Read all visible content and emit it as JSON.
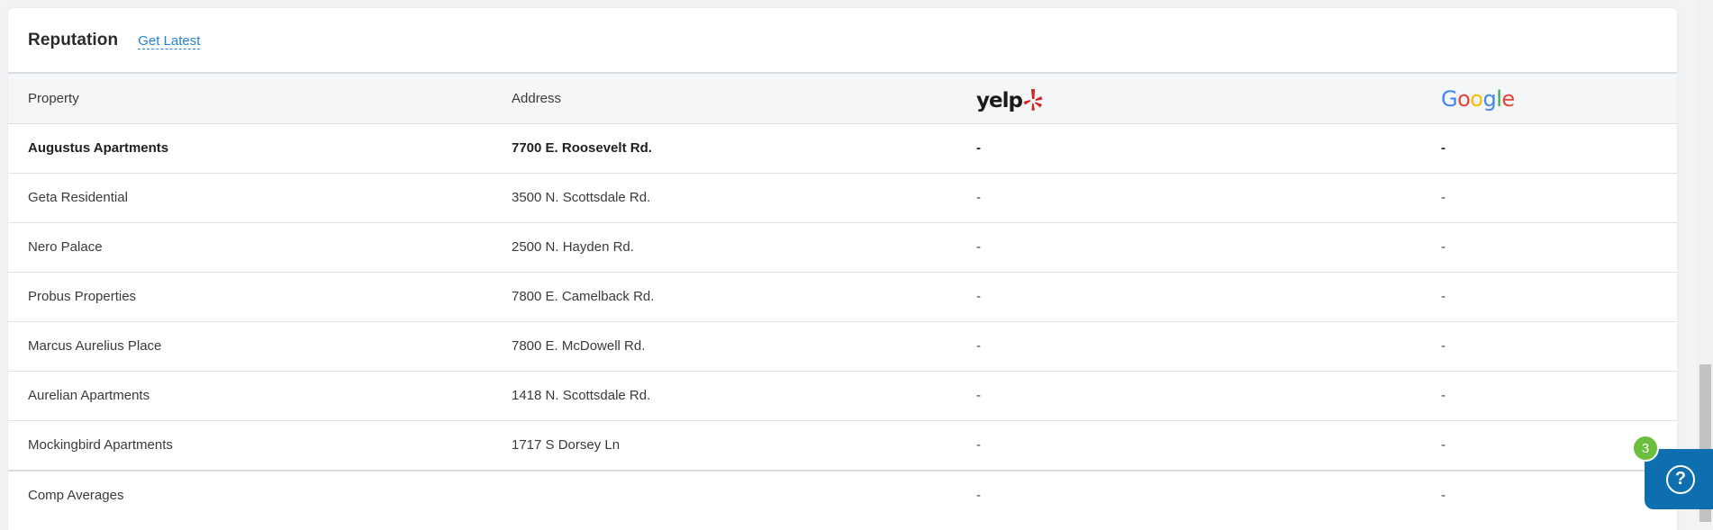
{
  "card": {
    "title": "Reputation",
    "get_latest": "Get Latest"
  },
  "table": {
    "headers": {
      "property": "Property",
      "address": "Address",
      "yelp_icon": "yelp-logo-icon",
      "google_icon": "google-logo-icon"
    },
    "logos": {
      "yelp_text": "yelp",
      "google_letters": [
        "G",
        "o",
        "o",
        "g",
        "l",
        "e"
      ],
      "google_colors": [
        "#4285F4",
        "#EA4335",
        "#FBBC05",
        "#4285F4",
        "#34A853",
        "#EA4335"
      ],
      "yelp_burst_color": "#d32323"
    },
    "rows": [
      {
        "property": "Augustus Apartments",
        "address": "7700 E. Roosevelt Rd.",
        "yelp": "-",
        "google": "-"
      },
      {
        "property": "Geta Residential",
        "address": "3500 N. Scottsdale Rd.",
        "yelp": "-",
        "google": "-"
      },
      {
        "property": "Nero Palace",
        "address": "2500 N. Hayden Rd.",
        "yelp": "-",
        "google": "-"
      },
      {
        "property": "Probus Properties",
        "address": "7800 E. Camelback Rd.",
        "yelp": "-",
        "google": "-"
      },
      {
        "property": "Marcus Aurelius Place",
        "address": "7800 E. McDowell Rd.",
        "yelp": "-",
        "google": "-"
      },
      {
        "property": "Aurelian Apartments",
        "address": "1418 N. Scottsdale Rd.",
        "yelp": "-",
        "google": "-"
      },
      {
        "property": "Mockingbird Apartments",
        "address": "1717 S Dorsey Ln",
        "yelp": "-",
        "google": "-"
      }
    ],
    "averages": {
      "property": "Comp Averages",
      "address": "",
      "yelp": "-",
      "google": "-"
    }
  },
  "help": {
    "icon": "question-circle-icon",
    "badge_count": "3",
    "accent_color": "#0d6eb0",
    "badge_color": "#6cbf3e"
  }
}
